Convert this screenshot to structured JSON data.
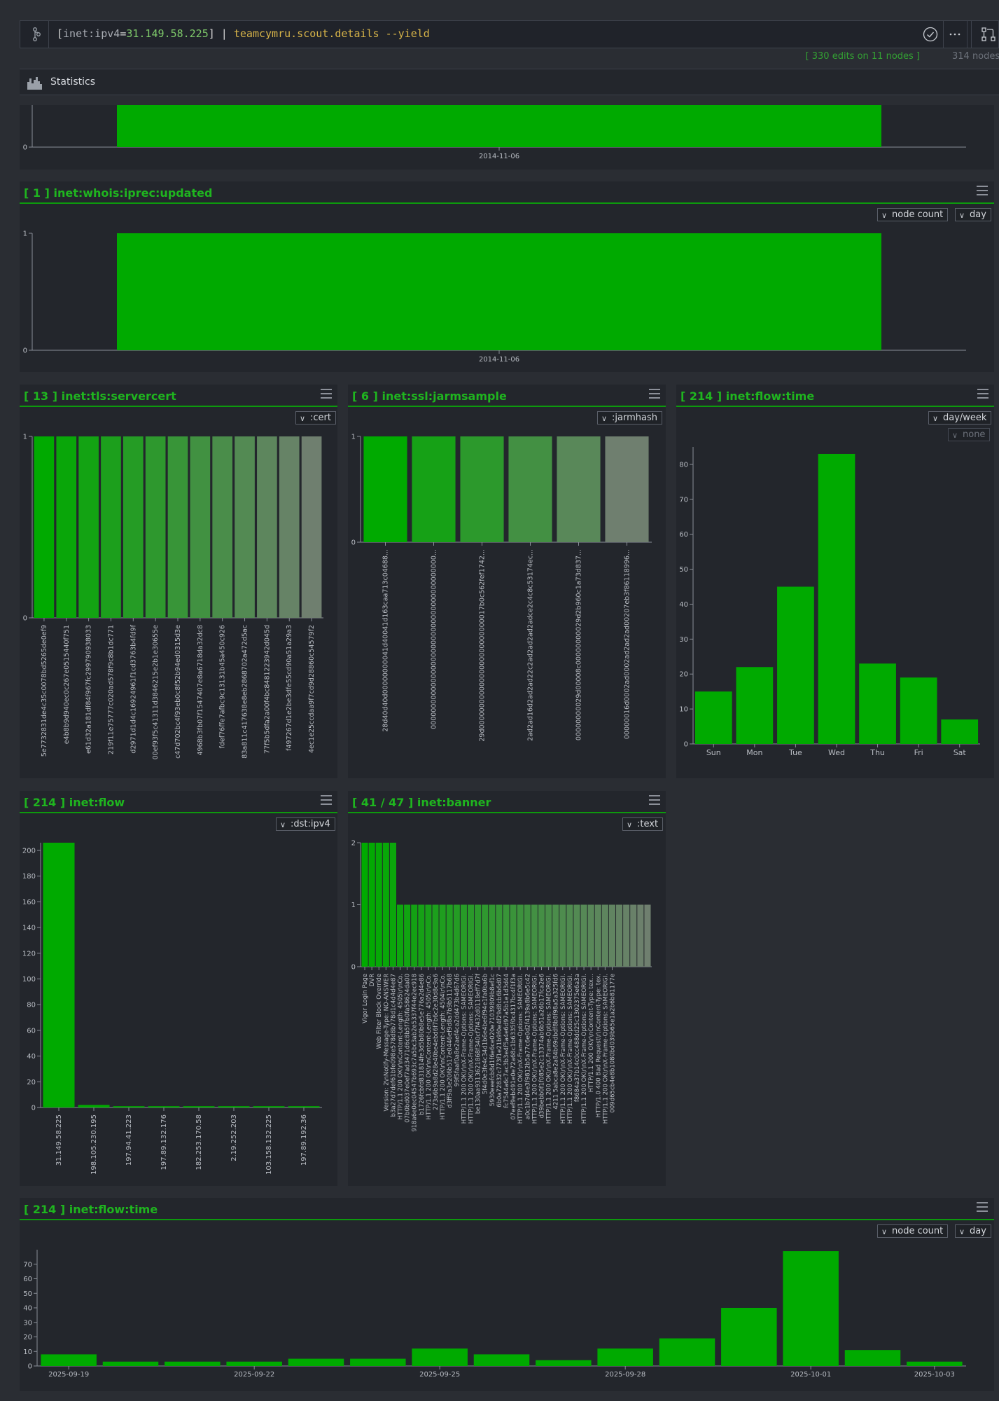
{
  "query": {
    "open_bracket": "[",
    "keyword": "inet:ipv4",
    "equals": "=",
    "ip": "31.149.58.225",
    "close_bracket": "]",
    "pipe": " | ",
    "command": "teamcymru.scout.details --yield"
  },
  "status": {
    "edits": "[ 330 edits on 11 nodes ]",
    "nodes": "314 nodes"
  },
  "stats": {
    "title": "Statistics"
  },
  "colors": {
    "accent": "#1fb51f",
    "bar": "#00aa00",
    "background": "#2a2d33",
    "panel": "#23262c"
  },
  "panels": {
    "top": {
      "x_label": "2014-11-06",
      "y_label": "0"
    },
    "whois": {
      "title": "[ 1 ] inet:whois:iprec:updated",
      "dd1": "node count",
      "dd2": "day"
    },
    "tls": {
      "title": "[ 13 ] inet:tls:servercert",
      "dd1": ":cert"
    },
    "jarm": {
      "title": "[ 6 ] inet:ssl:jarmsample",
      "dd1": ":jarmhash"
    },
    "flowweek": {
      "title": "[ 214 ] inet:flow:time",
      "dd1": "day/week",
      "dd2": "none"
    },
    "flow": {
      "title": "[ 214 ] inet:flow",
      "dd1": ":dst:ipv4"
    },
    "banner": {
      "title": "[ 41 / 47 ] inet:banner",
      "dd1": ":text"
    },
    "flowtime": {
      "title": "[ 214 ] inet:flow:time",
      "dd1": "node count",
      "dd2": "day"
    }
  },
  "chart_data": [
    {
      "id": "top",
      "type": "bar",
      "categories": [
        "2014-11-06"
      ],
      "values": [
        1
      ],
      "ylim": [
        0,
        1
      ]
    },
    {
      "id": "whois",
      "type": "bar",
      "categories": [
        "2014-11-06"
      ],
      "values": [
        1
      ],
      "ylim": [
        0,
        1
      ],
      "title": "[ 1 ] inet:whois:iprec:updated"
    },
    {
      "id": "tls",
      "type": "bar",
      "title": "[ 13 ] inet:tls:servercert",
      "ylim": [
        0,
        1
      ],
      "categories": [
        "5e7732831de4c35c0078bd5265de0ef9",
        "e4b8b9d940ec0c267e0515440f751",
        "e61d32a181df84f967fc299790938033",
        "219f11e75777c020ad578f9c8b1dc771",
        "d2971d1d4c16924961f1cd3763b4fd9f",
        "00ef93f5c41311d3846215e2b1e30655e",
        "c47d702bc4f93eb0c8f52b94ed0315d3e",
        "4968b3fb07f1547407e8a6718da32dc8",
        "fdef76ffe7afbc9c13131b45a450c926",
        "83a811c417638e8eb2868702a472d5ac",
        "77f5b5dfa2a00f4bc8481223942d045d",
        "f497267d1e2be3dfe55cd90a51a29a3",
        "4ec1e25ccdaa9f7cd9d28860c54579f2"
      ],
      "values": [
        1,
        1,
        1,
        1,
        1,
        1,
        1,
        1,
        1,
        1,
        1,
        1,
        1
      ]
    },
    {
      "id": "jarm",
      "type": "bar",
      "title": "[ 6 ] inet:ssl:jarmsample",
      "ylim": [
        0,
        1
      ],
      "categories": [
        "28d40d40d00000000041d40041d163caa713c04688...",
        "00000000000000000000000000000000000000000...",
        "29d00000000000000000000000000017b0c562fef1742...",
        "2ad2ad16d2ad2ad22c2ad2ad2ad2adce2c4c8c53174ec...",
        "00000000029d00008c00000000029d2b960c1a73d837...",
        "00000016d0002ad0002ad2ad2ad00207eb3f86118996..."
      ],
      "values": [
        1,
        1,
        1,
        1,
        1,
        1
      ]
    },
    {
      "id": "flowweek",
      "type": "bar",
      "title": "[ 214 ] inet:flow:time",
      "ylim": [
        0,
        85
      ],
      "categories": [
        "Sun",
        "Mon",
        "Tue",
        "Wed",
        "Thu",
        "Fri",
        "Sat"
      ],
      "values": [
        15,
        22,
        45,
        83,
        23,
        19,
        7
      ]
    },
    {
      "id": "flow",
      "type": "bar",
      "title": "[ 214 ] inet:flow",
      "ylim": [
        0,
        206
      ],
      "categories": [
        "31.149.58.225",
        "198.105.230.195",
        "197.94.41.223",
        "197.89.132.176",
        "182.253.170.58",
        "2.19.252.203",
        "103.158.132.225",
        "197.89.192.36"
      ],
      "values": [
        206,
        2,
        1,
        1,
        1,
        1,
        1,
        1
      ]
    },
    {
      "id": "banner",
      "type": "bar",
      "title": "[ 41 / 47 ] inet:banner",
      "ylim": [
        0,
        2
      ],
      "categories": [
        "Vigor Login Page",
        "DVR",
        "Web Filter Block Override",
        "Version: 2\\nNotify-Message-Type: NO-ANSWER",
        "b3a27d7def61bfe098e578d8b778d1c4d4d4e87",
        "HTTP/1.1 200 OK\\r\\nContent-Length: 4505\\r\\nCo...",
        "07b0bd037e0ef7ad3471d6c8b5f7b0fa58624da00",
        "918a6e0ec04547b693c7a5bc3ab2e5337f44e2ec918",
        "b1726fcbfd831814fe3d5b80b8e5e776a2d4e86",
        "HTTP/1.1 200 OK\\r\\nContent-Length: 4505\\r\\nCo...",
        "273a6b9a8d28e40be4ebd6f7b6c2e30d8c9a6",
        "HTTP/1.1 200 OK\\r\\nContent-Length: 4504\\r\\nCo...",
        "d3ff9a3e206b517e0446ef9d8a7b9b5117b68",
        "99f5faaf0a8e2aef4ca2dd473b4d67d6",
        "HTTP/1.1 200 OK\\r\\nX-Frame-Options: SAMEORIGI...",
        "HTTP/1.1 200 OK\\r\\nX-Frame-Options: SAMEORIGI...",
        "be130aa9313621868f340cf7f432d0118eff7d7f",
        "5f4d0e3fe4c34d1b6e4be6f94e1fa0ba6b",
        "5930eeefcb8d1f6e6ce020e71039809b8ef1c",
        "6b0a72832c773f1e21b9f0e4f29d8cb6b6d07",
        "fc7544a6c7ac3b3e4f5a4e6d97a5b1e1d3d44",
        "07eef9eb491e0e72a68c1b6335f0c4317bc4f1f3a",
        "HTTP/1.1 200 OK\\r\\nX-Frame-Options: SAMEORIGI...",
        "a0c1b7d4e3f9812b5a77c6e0d2f4139a8b6e5c42",
        "HTTP/1.1 200 OK\\r\\nX-Frame-Options: SAMEORIGI...",
        "d39bebb0f1f085e2c13374ab6b51a26b17fca2e6",
        "HTTP/1.1 200 OK\\r\\nX-Frame-Options: SAMEORIGI...",
        "4211 5abca8e2a84b69dbdf8b8f98a5a325fd6",
        "HTTP/1.1 200 OK\\r\\nX-Frame-Options: SAMEORIGI...",
        "HTTP/1.1 200 OK\\r\\nX-Frame-Options: SAMEORIGI...",
        "f8684a37b14c0cc488dd25c1302375e6a3a",
        "HTTP/1.1 200 OK\\r\\nX-Frame-Options: SAMEORIGI...",
        "HTTP/1.1 200 OK\\r\\nContent-Type: tex...",
        "HTTP/1.0 400 Bad Request\\r\\nContent-Type: tex...",
        "HTTP/1.1 200 OK\\r\\nX-Frame-Options: SAMEORIGI...",
        "009d65cb4e8b1080bd039b65e1a2b6b81177e"
      ],
      "values": [
        2,
        2,
        2,
        2,
        2,
        1,
        1,
        1,
        1,
        1,
        1,
        1,
        1,
        1,
        1,
        1,
        1,
        1,
        1,
        1,
        1,
        1,
        1,
        1,
        1,
        1,
        1,
        1,
        1,
        1,
        1,
        1,
        1,
        1,
        1,
        1,
        1,
        1,
        1,
        1,
        1
      ]
    },
    {
      "id": "flowtime",
      "type": "bar",
      "title": "[ 214 ] inet:flow:time",
      "ylim": [
        0,
        80
      ],
      "categories": [
        "2025-09-19",
        "2025-09-20",
        "2025-09-21",
        "2025-09-22",
        "2025-09-23",
        "2025-09-24",
        "2025-09-25",
        "2025-09-26",
        "2025-09-27",
        "2025-09-28",
        "2025-09-29",
        "2025-09-30",
        "2025-10-01",
        "2025-10-02",
        "2025-10-03"
      ],
      "tick_labels": [
        "2025-09-19",
        "2025-09-22",
        "2025-09-25",
        "2025-09-28",
        "2025-10-01",
        "2025-10-03"
      ],
      "values": [
        8,
        3,
        3,
        3,
        5,
        5,
        12,
        8,
        4,
        12,
        19,
        40,
        79,
        11,
        3
      ]
    }
  ]
}
